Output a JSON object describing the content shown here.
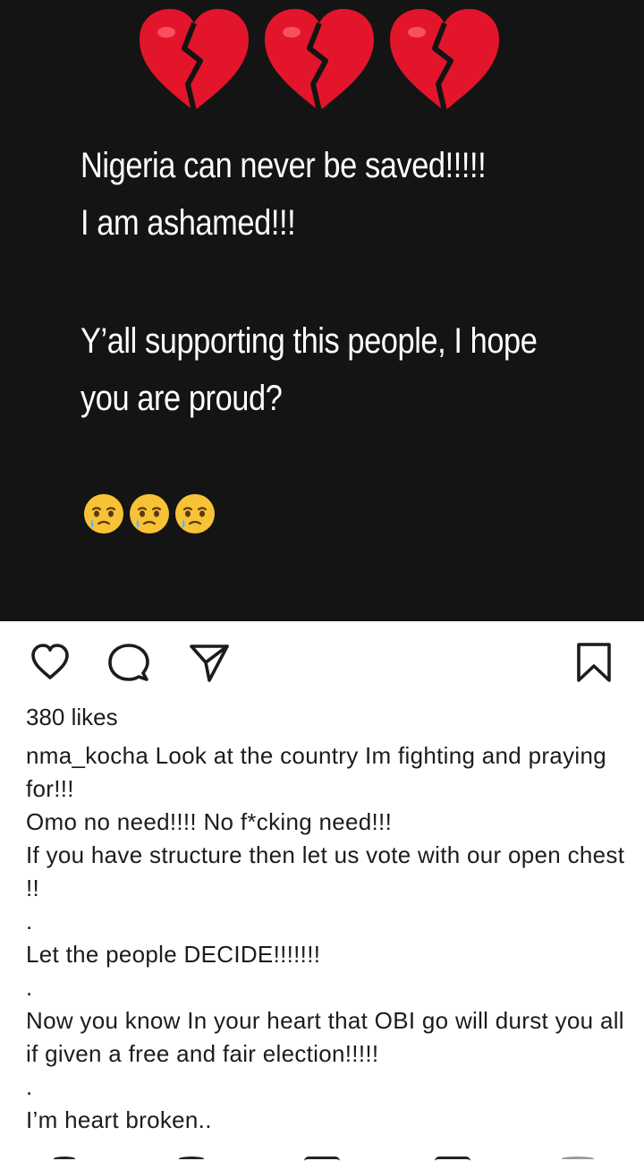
{
  "post": {
    "emoji_top": [
      "broken-heart",
      "broken-heart",
      "broken-heart"
    ],
    "lines": [
      "Nigeria can never be saved!!!!!",
      "I am ashamed!!!",
      "Y’all supporting this people, I hope",
      "you are proud?"
    ],
    "emoji_bottom": [
      "face-holding-back-tears",
      "face-holding-back-tears",
      "face-holding-back-tears"
    ],
    "colors": {
      "background": "#141414",
      "text": "#ffffff",
      "heart": "#e3152b"
    }
  },
  "actions": {
    "like_icon": "heart-outline-icon",
    "comment_icon": "comment-bubble-icon",
    "share_icon": "paper-plane-icon",
    "save_icon": "bookmark-icon"
  },
  "likes_text": "380 likes",
  "caption": {
    "username": "nma_kocha",
    "first_line": "Look at the country Im fighting and praying for!!!",
    "lines": [
      "Omo no need!!!! No f*cking need!!!",
      "If you have structure then let us vote with our open chest !!",
      ".",
      "Let the people DECIDE!!!!!!!",
      ".",
      "Now you know In your heart that OBI go will durst you all if given a free and fair election!!!!!",
      ".",
      "I’m heart broken.."
    ]
  }
}
